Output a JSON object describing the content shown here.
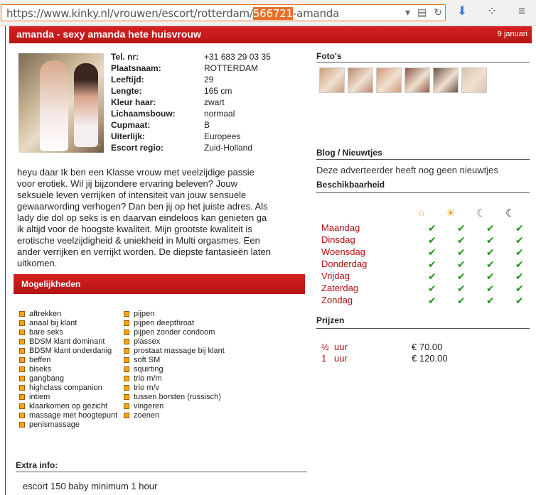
{
  "browser": {
    "url_prefix": "https://www.kinky.nl/vrouwen/escort/rotterdam/",
    "url_highlight": "566721",
    "url_suffix": "-amanda"
  },
  "header": {
    "title": "amanda - sexy amanda hete huisvrouw",
    "date": "9 januari"
  },
  "profile": [
    {
      "label": "Tel. nr:",
      "value": "+31 683 29 03 35"
    },
    {
      "label": "Plaatsnaam:",
      "value": "ROTTERDAM"
    },
    {
      "label": "Leeftijd:",
      "value": "29"
    },
    {
      "label": "Lengte:",
      "value": "165 cm"
    },
    {
      "label": "Kleur haar:",
      "value": "zwart"
    },
    {
      "label": "Lichaamsbouw:",
      "value": "normaal"
    },
    {
      "label": "Cupmaat:",
      "value": "B"
    },
    {
      "label": "Uiterlijk:",
      "value": "Europees"
    },
    {
      "label": "Escort regio:",
      "value": "Zuid-Holland"
    }
  ],
  "description_lines": [
    "heyu daar Ik ben een Klasse vrouw met veelzijdige passie",
    "voor erotiek. Wil jij bijzondere ervaring beleven? Jouw",
    "seksuele leven verrijken of intensiteit van jouw sensuele",
    "gewaarwording verhogen? Dan ben jij op het juiste adres. Als",
    "lady die dol op seks is en daarvan eindeloos kan genieten ga",
    "ik altijd voor de hoogste kwaliteit. Mijn grootste kwaliteit is",
    "erotische veelzijdigheid & uniekheid in Multi orgasmes. Een",
    "ander verrijken en verrijkt worden. De diepste fantasieën laten",
    "uitkomen."
  ],
  "options_title": "Mogelijkheden",
  "options_col1": [
    "aftrekken",
    "anaal bij klant",
    "bare seks",
    "BDSM klant dominant",
    "BDSM klant onderdanig",
    "beffen",
    "biseks",
    "gangbang",
    "highclass companion",
    "intiem",
    "klaarkomen op gezicht",
    "massage met hoogtepunt",
    "penismassage"
  ],
  "options_col2": [
    "pijpen",
    "pijpen deepthroat",
    "pijpen zonder condoom",
    "plassex",
    "prostaat massage bij klant",
    "soft SM",
    "squirting",
    "trio m/m",
    "trio m/v",
    "tussen borsten (russisch)",
    "vingeren",
    "zoenen"
  ],
  "extra": {
    "title": "Extra info:",
    "value": "escort 150 baby minimum 1 hour"
  },
  "right": {
    "photos_title": "Foto's",
    "photo_colors": [
      "#c9a07a",
      "#b88a6e",
      "#d29a78",
      "#8e5a4a",
      "#6a5448",
      "#d8c4b0"
    ],
    "blog_title": "Blog / Nieuwtjes",
    "blog_text": "Deze adverteerder heeft nog geen nieuwtjes",
    "avail_title": "Beschikbaarheid",
    "avail_icons": [
      "sun-icon",
      "sun-bright-icon",
      "moon-icon",
      "moon-dark-icon"
    ],
    "days": [
      "Maandag",
      "Dinsdag",
      "Woensdag",
      "Donderdag",
      "Vrijdag",
      "Zaterdag",
      "Zondag"
    ],
    "prices_title": "Prijzen",
    "prices": [
      {
        "dur": "½",
        "unit": "uur",
        "price": "€ 70.00"
      },
      {
        "dur": "1",
        "unit": "uur",
        "price": "€ 120.00"
      }
    ]
  }
}
